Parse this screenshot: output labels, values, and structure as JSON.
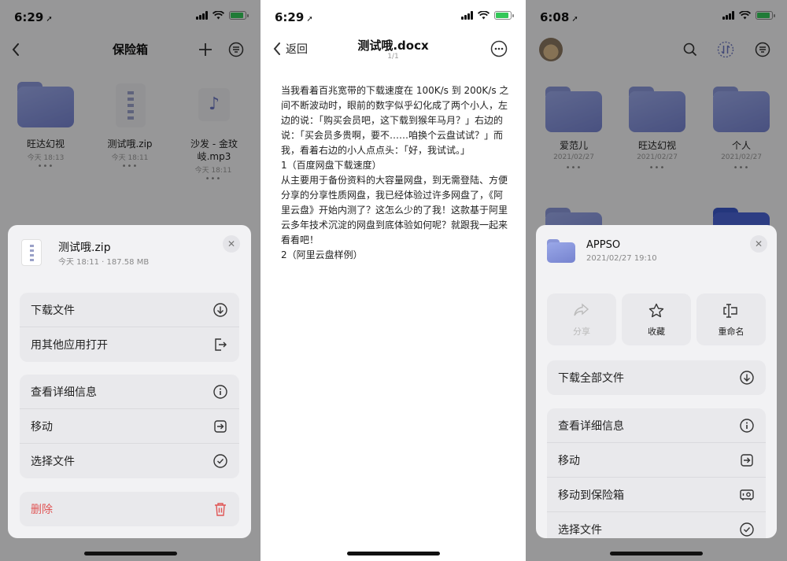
{
  "panel1": {
    "status_time": "6:29",
    "title": "保险箱",
    "tiles": [
      {
        "name": "旺达幻视",
        "date": "今天 18:13",
        "kind": "folder"
      },
      {
        "name": "测试哦.zip",
        "date": "今天 18:11",
        "kind": "zip"
      },
      {
        "name": "沙发 - 金玟岐.mp3",
        "date": "今天 18:11",
        "kind": "audio"
      }
    ],
    "sheet": {
      "file_name": "测试哦.zip",
      "file_meta": "今天 18:11 · 187.58 MB",
      "group1": [
        {
          "label": "下载文件",
          "icon": "download-icon"
        },
        {
          "label": "用其他应用打开",
          "icon": "open-external-icon"
        }
      ],
      "group2": [
        {
          "label": "查看详细信息",
          "icon": "info-icon"
        },
        {
          "label": "移动",
          "icon": "move-icon"
        },
        {
          "label": "选择文件",
          "icon": "check-circle-icon"
        }
      ],
      "delete_label": "删除"
    }
  },
  "panel2": {
    "status_time": "6:29",
    "back_label": "返回",
    "title": "测试哦.docx",
    "page_indicator": "1/1",
    "paragraphs": [
      "当我看着百兆宽带的下载速度在 100K/s 到 200K/s 之间不断波动时，眼前的数字似乎幻化成了两个小人，左边的说：「购买会员吧，这下载到猴年马月？」右边的说：「买会员多贵啊，要不……咱换个云盘试试？」而我，看着右边的小人点点头：「好，我试试。」",
      "1（百度网盘下载速度）",
      "从主要用于备份资料的大容量网盘，到无需登陆、方便分享的分享性质网盘，我已经体验过许多网盘了，《阿里云盘》开始内测了？这怎么少的了我！这款基于阿里云多年技术沉淀的网盘到底体验如何呢？就跟我一起来看看吧！",
      "2（阿里云盘样例）"
    ]
  },
  "panel3": {
    "status_time": "6:08",
    "tiles": [
      {
        "name": "爱范儿",
        "date": "2021/02/27"
      },
      {
        "name": "旺达幻视",
        "date": "2021/02/27"
      },
      {
        "name": "个人",
        "date": "2021/02/27"
      }
    ],
    "sheet": {
      "folder_name": "APPSO",
      "folder_date": "2021/02/27 19:10",
      "actions": [
        {
          "label": "分享",
          "icon": "share-icon",
          "disabled": true
        },
        {
          "label": "收藏",
          "icon": "star-icon",
          "disabled": false
        },
        {
          "label": "重命名",
          "icon": "rename-icon",
          "disabled": false
        }
      ],
      "download_all": "下载全部文件",
      "group2": [
        {
          "label": "查看详细信息",
          "icon": "info-icon"
        },
        {
          "label": "移动",
          "icon": "move-icon"
        },
        {
          "label": "移动到保险箱",
          "icon": "safe-box-icon"
        },
        {
          "label": "选择文件",
          "icon": "check-circle-icon"
        }
      ]
    }
  }
}
